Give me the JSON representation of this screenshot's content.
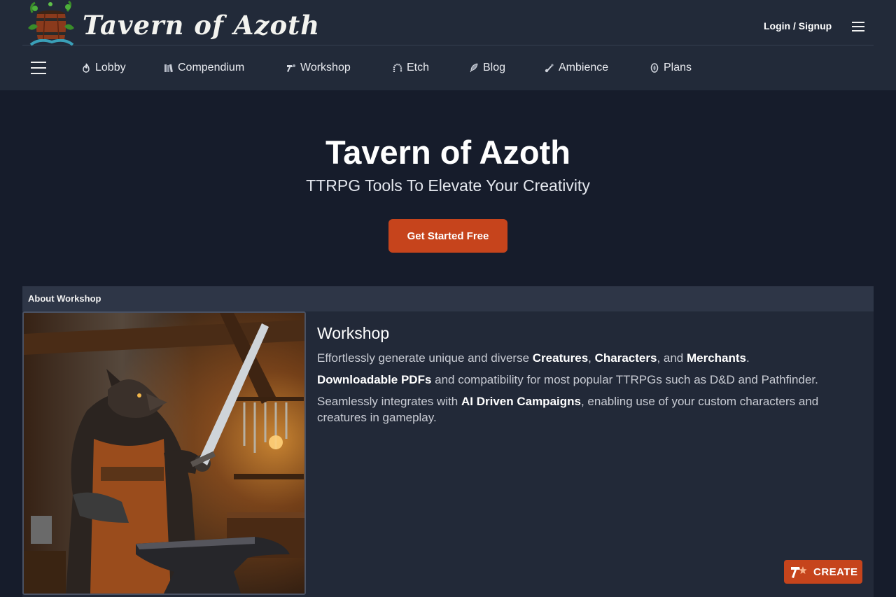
{
  "brand": {
    "name": "Tavern of Azoth"
  },
  "header": {
    "login_label": "Login / Signup"
  },
  "nav": {
    "items": [
      {
        "label": "Lobby",
        "icon": "flame-icon"
      },
      {
        "label": "Compendium",
        "icon": "books-icon"
      },
      {
        "label": "Workshop",
        "icon": "hammer-icon"
      },
      {
        "label": "Etch",
        "icon": "arch-icon"
      },
      {
        "label": "Blog",
        "icon": "feather-icon"
      },
      {
        "label": "Ambience",
        "icon": "music-icon"
      },
      {
        "label": "Plans",
        "icon": "coin-icon"
      }
    ]
  },
  "hero": {
    "title": "Tavern of Azoth",
    "subtitle": "TTRPG Tools To Elevate Your Creativity",
    "cta_label": "Get Started Free"
  },
  "about": {
    "header": "About Workshop",
    "title": "Workshop",
    "p1": {
      "a": "Effortlessly generate unique and diverse ",
      "b1": "Creatures",
      "c": ", ",
      "b2": "Characters",
      "d": ", and ",
      "b3": "Merchants",
      "e": "."
    },
    "p2": {
      "b1": "Downloadable PDFs",
      "a": " and compatibility for most popular TTRPGs such as D&D and Pathfinder."
    },
    "p3": {
      "a": "Seamlessly integrates with ",
      "b1": "AI Driven Campaigns",
      "c": ", enabling use of your custom characters and creatures in gameplay."
    },
    "image_alt": "werewolf blacksmith illustration"
  },
  "create_button": {
    "label": "CREATE"
  },
  "colors": {
    "accent": "#c6441c",
    "header_bg": "#222a39",
    "page_bg": "#161c2b"
  }
}
